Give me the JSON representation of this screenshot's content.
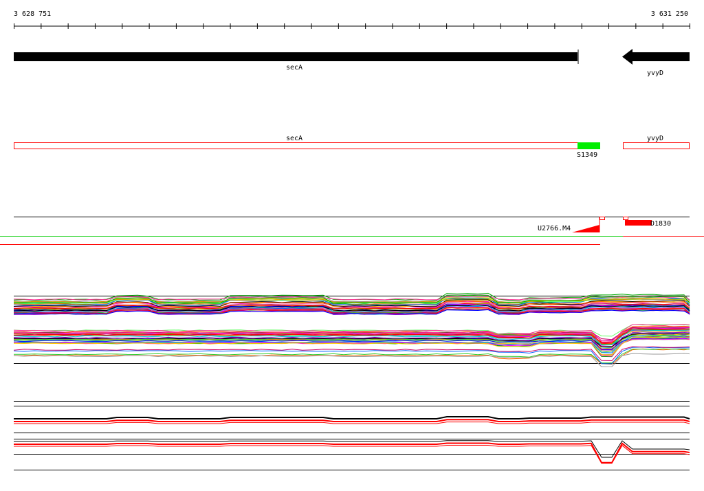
{
  "ruler": {
    "start_label": "3 628 751",
    "end_label": "3 631 250"
  },
  "genes": [
    {
      "name": "secA",
      "strand": "forward"
    },
    {
      "name": "yvyD",
      "strand": "reverse"
    }
  ],
  "annotation_track": {
    "boxes": [
      "secA",
      "yvyD"
    ],
    "feature_label": "S1349",
    "feature_color": "#00ee00"
  },
  "transcript_track": {
    "features": [
      {
        "label": "U2766.M4",
        "color": "#ff0000"
      },
      {
        "label": "D1830",
        "color": "#ff0000"
      }
    ]
  },
  "colors": {
    "gene_arrow": "#000000",
    "annotation_outline": "#ff0000",
    "green_line": "#00cc00",
    "red_line": "#ff0000"
  },
  "expression_profile_panel": {
    "palette": [
      "#000000",
      "#ff0000",
      "#00aa00",
      "#0000ff",
      "#ff00ff",
      "#00cccc",
      "#ffcc00",
      "#9900cc",
      "#ff6600",
      "#33cc33",
      "#0066ff",
      "#cc0066",
      "#999999",
      "#66ff66",
      "#cc9900",
      "#ff3399"
    ]
  },
  "summary_panel": {
    "line_colors": [
      "#000000",
      "#ff0000"
    ]
  }
}
